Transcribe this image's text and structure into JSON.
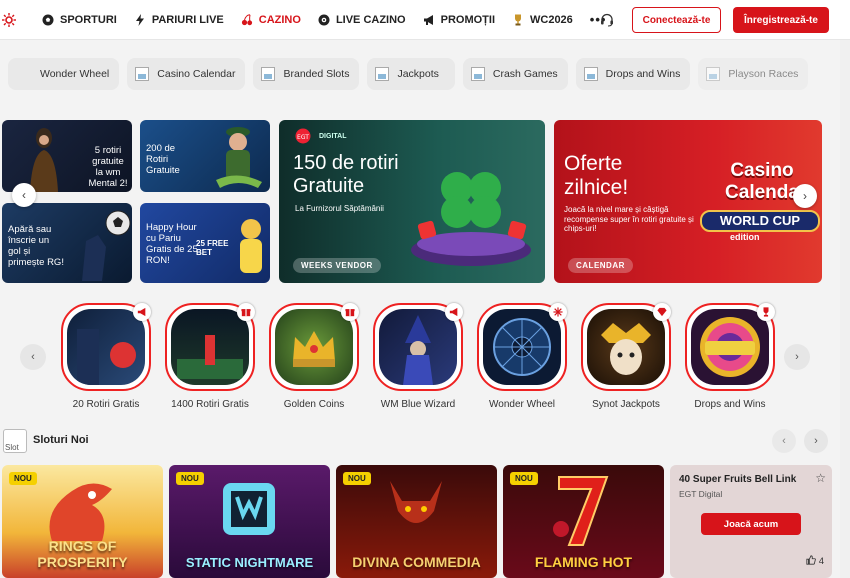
{
  "nav": {
    "items": [
      {
        "label": "SPORTURI",
        "icon": "soccer-ball-icon"
      },
      {
        "label": "PARIURI LIVE",
        "icon": "lightning-icon"
      },
      {
        "label": "CAZINO",
        "icon": "cherries-icon",
        "active": true
      },
      {
        "label": "LIVE CAZINO",
        "icon": "roulette-icon"
      },
      {
        "label": "PROMOȚII",
        "icon": "megaphone-icon"
      },
      {
        "label": "WC2026",
        "icon": "trophy-icon"
      }
    ],
    "more": "•••",
    "login": "Conectează-te",
    "register": "Înregistrează-te",
    "accent": "#d7141a"
  },
  "categories": [
    "Wonder Wheel",
    "Casino Calendar",
    "Branded Slots",
    "Jackpots",
    "Crash Games",
    "Drops and Wins",
    "Playson Races"
  ],
  "banners": {
    "b1": "5 rotiri gratuite la wm Mental 2!",
    "b2": "200 de Rotiri Gratuite",
    "b3": "Apără sau înscrie un gol și primește RG!",
    "b4": "Happy Hour cu Pariu Gratis de 25 RON!",
    "b4_badge": "25 FREE BET",
    "big1": {
      "brand": "DIGITAL",
      "title": "150 de rotiri Gratuite",
      "subtitle": "La Furnizorul Săptămânii",
      "pill": "WEEKS VENDOR"
    },
    "big2": {
      "title": "Oferte zilnice!",
      "subtitle": "Joacă la nivel mare și câștigă recompense super în rotiri gratuite și chips-uri!",
      "pill": "CALENDAR",
      "art_title": "Casino Calenda",
      "art_sub": "WORLD CUP",
      "art_edition": "edition"
    }
  },
  "stories": [
    {
      "label": "20 Rotiri Gratis",
      "badge": "megaphone-icon"
    },
    {
      "label": "1400 Rotiri Gratis",
      "badge": "gift-icon"
    },
    {
      "label": "Golden Coins",
      "badge": "gift-icon"
    },
    {
      "label": "WM Blue Wizard",
      "badge": "megaphone-icon"
    },
    {
      "label": "Wonder Wheel",
      "badge": "snowflake-icon"
    },
    {
      "label": "Synot Jackpots",
      "badge": "diamond-icon"
    },
    {
      "label": "Drops and Wins",
      "badge": "trophy-icon"
    }
  ],
  "section": {
    "title": "Sloturi Noi",
    "icon_alt": "Slot"
  },
  "games": [
    {
      "title": "RINGS OF PROSPERITY",
      "badge": "NOU"
    },
    {
      "title": "STATIC NIGHTMARE",
      "badge": "NOU"
    },
    {
      "title": "DIVINA COMMEDIA",
      "badge": "NOU"
    },
    {
      "title": "FLAMING HOT",
      "badge": "NOU"
    }
  ],
  "featured": {
    "name": "40 Super Fruits Bell Link",
    "provider": "EGT Digital",
    "play": "Joacă acum",
    "likes": "4"
  }
}
